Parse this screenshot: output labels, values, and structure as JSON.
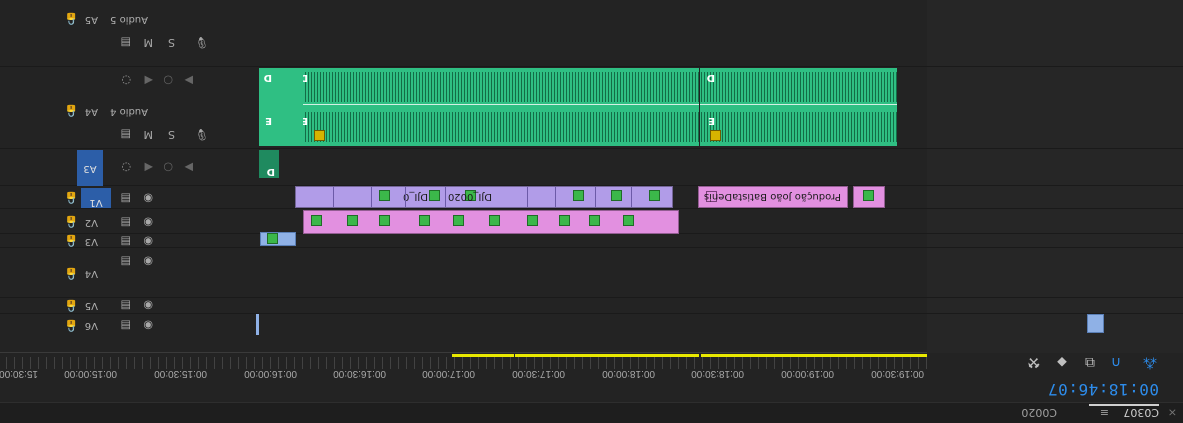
{
  "tabs": [
    {
      "label": "C0307",
      "active": true
    },
    {
      "label": "C0020",
      "active": false
    }
  ],
  "sequence": {
    "timecode": "00:18:46:07"
  },
  "ruler": {
    "labels": [
      "15:30:00",
      "00:15:00:00",
      "00:15:30:00",
      "00:16:00:00",
      "00:16:30:00",
      "00:17:00:00",
      "00:17:30:00",
      "00:18:00:00",
      "00:18:30:00",
      "00:19:00:00",
      "00:19:30:00",
      "00:17:30:00"
    ]
  },
  "tracks": {
    "v6": "V6",
    "v5": "V5",
    "v4": "V4",
    "v3": "V3",
    "v2": "V2",
    "v1": "V1",
    "a3": "A3",
    "a4": "A4",
    "a5": "A5",
    "audio4_name": "Audio 4",
    "audio5_name": "Audio 5",
    "mute": "M",
    "solo": "S"
  },
  "clips": {
    "v1_a": "DJI_0",
    "v1_b": "DJI_0020",
    "v1_title": "Produção João BatistaDenis",
    "fx_label": "fx"
  },
  "markers": {
    "d": "D",
    "e": "E"
  },
  "icons": [
    "lock-icon",
    "eye-icon",
    "film-icon",
    "voice-icon",
    "keyframe-icon",
    "snap-icon",
    "linked-selection-icon",
    "marker-add-icon",
    "wrench-icon",
    "nest-icon",
    "menu-icon"
  ],
  "colors": {
    "accent": "#2d8ceb",
    "audio_clip": "#2fbf83",
    "video_purple": "#b19ce8",
    "video_pink": "#e290e0",
    "work_area": "#e8e800"
  }
}
